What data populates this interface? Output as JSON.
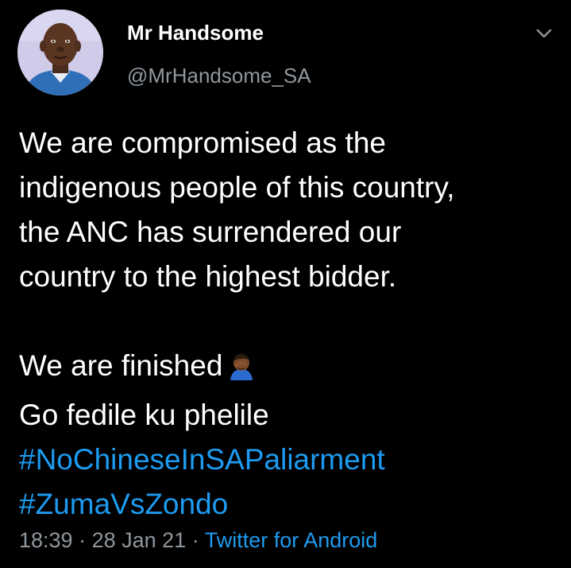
{
  "tweet": {
    "author": {
      "display_name": "Mr Handsome",
      "handle": "@MrHandsome_SA",
      "avatar_icon": "profile-photo"
    },
    "menu_icon": "chevron-down-icon",
    "body_lines": [
      "We are compromised as the",
      "indigenous people of this country,",
      "the ANC  has surrendered our",
      "country to the highest bidder."
    ],
    "body_lines_2": [
      "We are finished",
      "Go fedile ku phelile"
    ],
    "emoji": "person-facepalming-emoji",
    "hashtags": [
      "#NoChineseInSAPaliarment",
      "#ZumaVsZondo"
    ],
    "meta": {
      "time": "18:39",
      "separator": " · ",
      "date": "28 Jan 21",
      "source": "Twitter for Android"
    }
  },
  "colors": {
    "background": "#000000",
    "text": "#ffffff",
    "secondary_text": "#8f979e",
    "link": "#1d9bf0"
  }
}
